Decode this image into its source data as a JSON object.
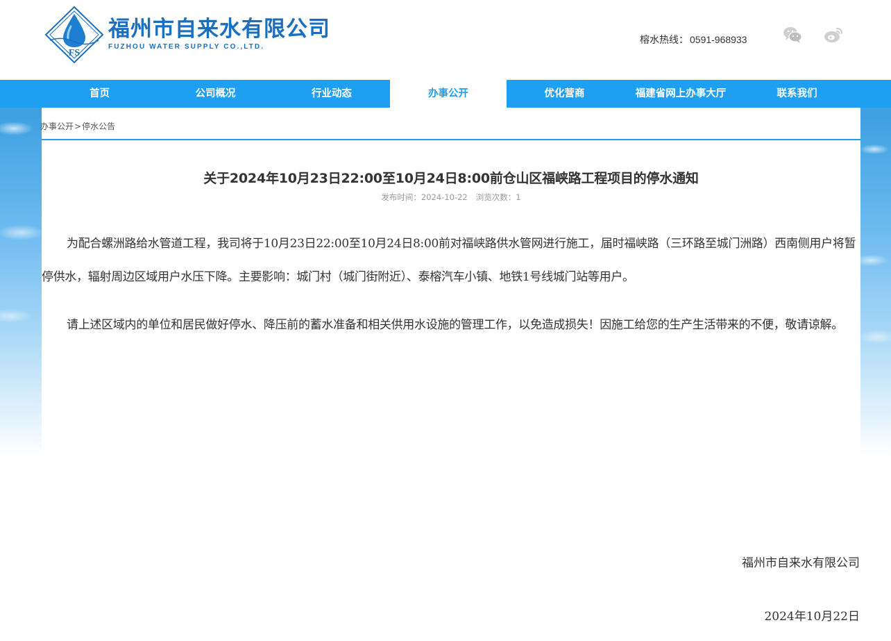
{
  "header": {
    "brand_cn": "福州市自来水有限公司",
    "brand_en": "FUZHOU WATER SUPPLY CO.,LTD.",
    "logo_letters": "FS",
    "hotline_label": "榕水热线：",
    "hotline_number": "0591-968933",
    "social_icons": [
      "wechat-icon",
      "weibo-icon"
    ]
  },
  "nav": {
    "items": [
      {
        "label": "首页"
      },
      {
        "label": "公司概况"
      },
      {
        "label": "行业动态"
      },
      {
        "label": "办事公开"
      },
      {
        "label": "优化营商"
      },
      {
        "label": "福建省网上办事大厅"
      },
      {
        "label": "联系我们"
      }
    ],
    "active": "办事公开"
  },
  "breadcrumb": {
    "parent": "办事公开",
    "separator": ">",
    "current": "停水公告"
  },
  "article": {
    "title": "关于2024年10月23日22:00至10月24日8:00前仓山区福峡路工程项目的停水通知",
    "publish_label": "发布时间：",
    "publish_date": "2024-10-22",
    "views_label": "浏览次数：",
    "views": "1",
    "paragraphs": [
      "为配合螺洲路给水管道工程，我司将于10月23日22:00至10月24日8:00前对福峡路供水管网进行施工，届时福峡路（三环路至城门洲路）西南侧用户将暂停供水，辐射周边区域用户水压下降。主要影响：城门村（城门街附近）、泰榕汽车小镇、地铁1号线城门站等用户。",
      "请上述区域内的单位和居民做好停水、降压前的蓄水准备和相关供用水设施的管理工作，以免造成损失！因施工给您的生产生活带来的不便，敬请谅解。"
    ],
    "signature_company": "福州市自来水有限公司",
    "signature_date": "2024年10月22日"
  },
  "colors": {
    "brand_blue": "#1a6fc0",
    "nav_blue": "#1e9ff2",
    "text": "#333333",
    "meta_gray": "#999999"
  }
}
